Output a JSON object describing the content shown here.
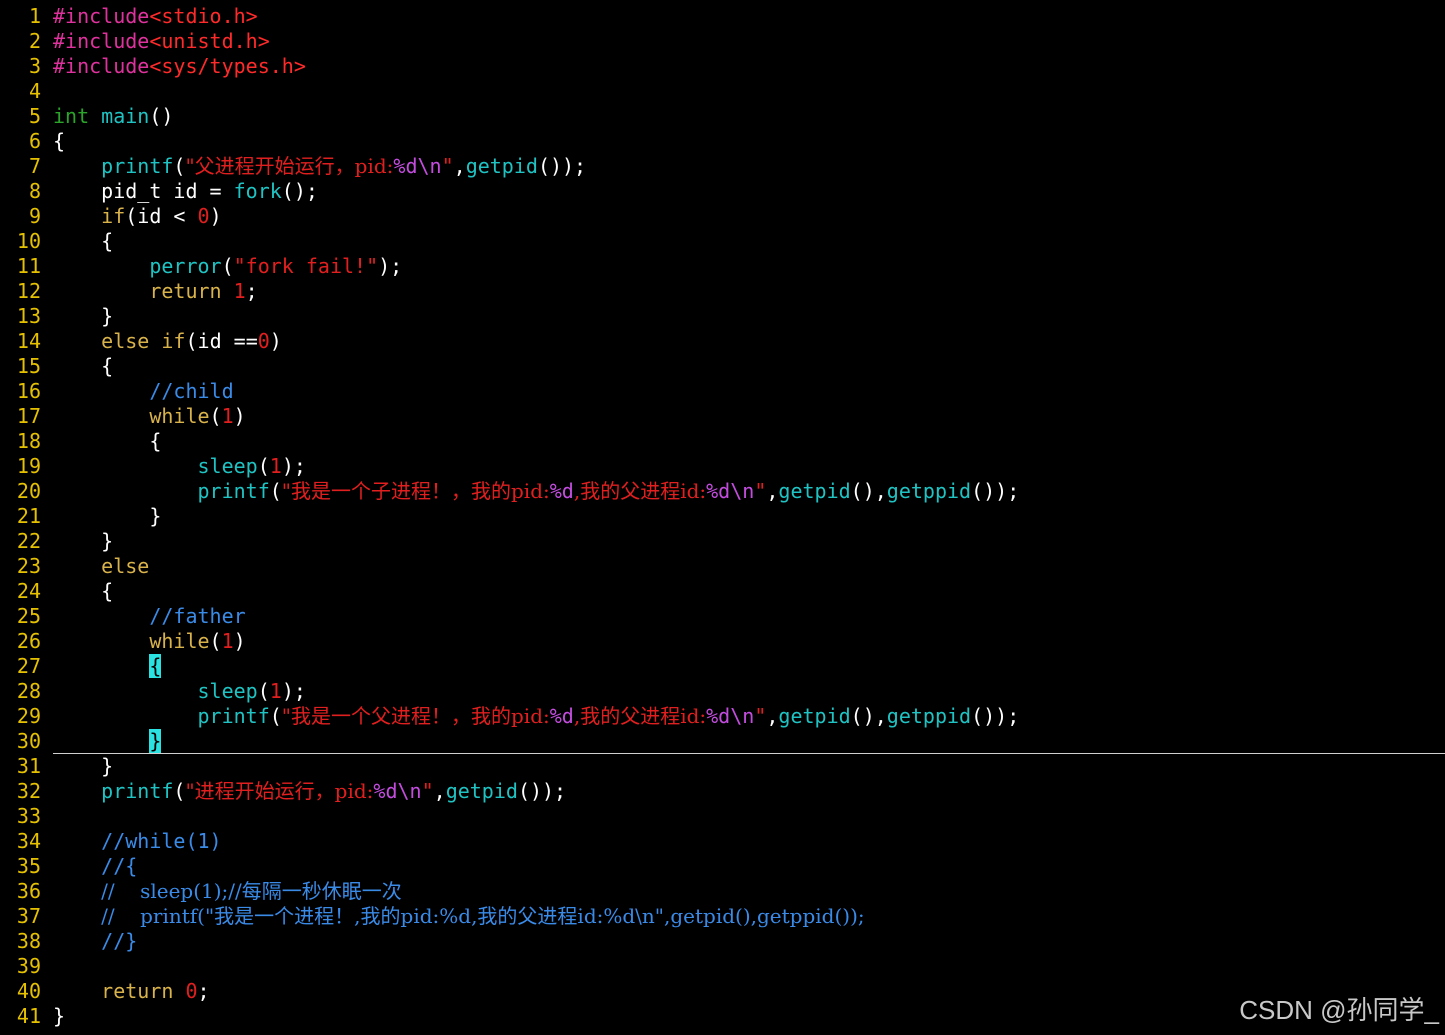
{
  "editor": {
    "lines": [
      {
        "n": "1",
        "tokens": [
          [
            "pre",
            "#include"
          ],
          [
            "inc",
            "<stdio.h>"
          ]
        ]
      },
      {
        "n": "2",
        "tokens": [
          [
            "pre",
            "#include"
          ],
          [
            "inc",
            "<unistd.h>"
          ]
        ]
      },
      {
        "n": "3",
        "tokens": [
          [
            "pre",
            "#include"
          ],
          [
            "inc",
            "<sys/types.h>"
          ]
        ]
      },
      {
        "n": "4",
        "tokens": []
      },
      {
        "n": "5",
        "tokens": [
          [
            "type",
            "int"
          ],
          [
            "plain",
            " "
          ],
          [
            "func",
            "main"
          ],
          [
            "plain",
            "()"
          ]
        ]
      },
      {
        "n": "6",
        "tokens": [
          [
            "plain",
            "{"
          ]
        ]
      },
      {
        "n": "7",
        "tokens": [
          [
            "plain",
            "    "
          ],
          [
            "func",
            "printf"
          ],
          [
            "plain",
            "("
          ],
          [
            "str",
            "\"父进程开始运行，pid:"
          ],
          [
            "esc",
            "%d\\n"
          ],
          [
            "str",
            "\""
          ],
          [
            "plain",
            ","
          ],
          [
            "func",
            "getpid"
          ],
          [
            "plain",
            "());"
          ]
        ]
      },
      {
        "n": "8",
        "tokens": [
          [
            "plain",
            "    pid_t id = "
          ],
          [
            "func",
            "fork"
          ],
          [
            "plain",
            "();"
          ]
        ]
      },
      {
        "n": "9",
        "tokens": [
          [
            "plain",
            "    "
          ],
          [
            "kw",
            "if"
          ],
          [
            "plain",
            "(id < "
          ],
          [
            "num",
            "0"
          ],
          [
            "plain",
            ")"
          ]
        ]
      },
      {
        "n": "10",
        "tokens": [
          [
            "plain",
            "    {"
          ]
        ]
      },
      {
        "n": "11",
        "tokens": [
          [
            "plain",
            "        "
          ],
          [
            "func",
            "perror"
          ],
          [
            "plain",
            "("
          ],
          [
            "str",
            "\"fork fail!\""
          ],
          [
            "plain",
            ");"
          ]
        ]
      },
      {
        "n": "12",
        "tokens": [
          [
            "plain",
            "        "
          ],
          [
            "kw",
            "return"
          ],
          [
            "plain",
            " "
          ],
          [
            "num",
            "1"
          ],
          [
            "plain",
            ";"
          ]
        ]
      },
      {
        "n": "13",
        "tokens": [
          [
            "plain",
            "    }"
          ]
        ]
      },
      {
        "n": "14",
        "tokens": [
          [
            "plain",
            "    "
          ],
          [
            "kw",
            "else"
          ],
          [
            "plain",
            " "
          ],
          [
            "kw",
            "if"
          ],
          [
            "plain",
            "(id =="
          ],
          [
            "num",
            "0"
          ],
          [
            "plain",
            ")"
          ]
        ]
      },
      {
        "n": "15",
        "tokens": [
          [
            "plain",
            "    {"
          ]
        ]
      },
      {
        "n": "16",
        "tokens": [
          [
            "plain",
            "        "
          ],
          [
            "cmt",
            "//child"
          ]
        ]
      },
      {
        "n": "17",
        "tokens": [
          [
            "plain",
            "        "
          ],
          [
            "kw",
            "while"
          ],
          [
            "plain",
            "("
          ],
          [
            "num",
            "1"
          ],
          [
            "plain",
            ")"
          ]
        ]
      },
      {
        "n": "18",
        "tokens": [
          [
            "plain",
            "        {"
          ]
        ]
      },
      {
        "n": "19",
        "tokens": [
          [
            "plain",
            "            "
          ],
          [
            "func",
            "sleep"
          ],
          [
            "plain",
            "("
          ],
          [
            "num",
            "1"
          ],
          [
            "plain",
            ");"
          ]
        ]
      },
      {
        "n": "20",
        "tokens": [
          [
            "plain",
            "            "
          ],
          [
            "func",
            "printf"
          ],
          [
            "plain",
            "("
          ],
          [
            "str",
            "\"我是一个子进程！，我的pid:"
          ],
          [
            "esc",
            "%d"
          ],
          [
            "str",
            ",我的父进程id:"
          ],
          [
            "esc",
            "%d\\n"
          ],
          [
            "str",
            "\""
          ],
          [
            "plain",
            ","
          ],
          [
            "func",
            "getpid"
          ],
          [
            "plain",
            "(),"
          ],
          [
            "func",
            "getppid"
          ],
          [
            "plain",
            "());"
          ]
        ]
      },
      {
        "n": "21",
        "tokens": [
          [
            "plain",
            "        }"
          ]
        ]
      },
      {
        "n": "22",
        "tokens": [
          [
            "plain",
            "    }"
          ]
        ]
      },
      {
        "n": "23",
        "tokens": [
          [
            "plain",
            "    "
          ],
          [
            "kw",
            "else"
          ]
        ]
      },
      {
        "n": "24",
        "tokens": [
          [
            "plain",
            "    {"
          ]
        ]
      },
      {
        "n": "25",
        "tokens": [
          [
            "plain",
            "        "
          ],
          [
            "cmt",
            "//father"
          ]
        ]
      },
      {
        "n": "26",
        "tokens": [
          [
            "plain",
            "        "
          ],
          [
            "kw",
            "while"
          ],
          [
            "plain",
            "("
          ],
          [
            "num",
            "1"
          ],
          [
            "plain",
            ")"
          ]
        ]
      },
      {
        "n": "27",
        "tokens": [
          [
            "plain",
            "        "
          ],
          [
            "cur",
            "{"
          ]
        ]
      },
      {
        "n": "28",
        "tokens": [
          [
            "plain",
            "            "
          ],
          [
            "func",
            "sleep"
          ],
          [
            "plain",
            "("
          ],
          [
            "num",
            "1"
          ],
          [
            "plain",
            ");"
          ]
        ]
      },
      {
        "n": "29",
        "tokens": [
          [
            "plain",
            "            "
          ],
          [
            "func",
            "printf"
          ],
          [
            "plain",
            "("
          ],
          [
            "str",
            "\"我是一个父进程！，我的pid:"
          ],
          [
            "esc",
            "%d"
          ],
          [
            "str",
            ",我的父进程id:"
          ],
          [
            "esc",
            "%d\\n"
          ],
          [
            "str",
            "\""
          ],
          [
            "plain",
            ","
          ],
          [
            "func",
            "getpid"
          ],
          [
            "plain",
            "(),"
          ],
          [
            "func",
            "getppid"
          ],
          [
            "plain",
            "());"
          ]
        ]
      },
      {
        "n": "30",
        "tokens": [
          [
            "plain",
            "        "
          ],
          [
            "cur",
            "}"
          ]
        ],
        "cursorline": true
      },
      {
        "n": "31",
        "tokens": [
          [
            "plain",
            "    }"
          ]
        ]
      },
      {
        "n": "32",
        "tokens": [
          [
            "plain",
            "    "
          ],
          [
            "func",
            "printf"
          ],
          [
            "plain",
            "("
          ],
          [
            "str",
            "\"进程开始运行，pid:"
          ],
          [
            "esc",
            "%d\\n"
          ],
          [
            "str",
            "\""
          ],
          [
            "plain",
            ","
          ],
          [
            "func",
            "getpid"
          ],
          [
            "plain",
            "());"
          ]
        ]
      },
      {
        "n": "33",
        "tokens": []
      },
      {
        "n": "34",
        "tokens": [
          [
            "plain",
            "    "
          ],
          [
            "cmt",
            "//while(1)"
          ]
        ]
      },
      {
        "n": "35",
        "tokens": [
          [
            "plain",
            "    "
          ],
          [
            "cmt",
            "//{"
          ]
        ]
      },
      {
        "n": "36",
        "tokens": [
          [
            "plain",
            "    "
          ],
          [
            "cmt",
            "//    sleep(1);//每隔一秒休眠一次"
          ]
        ]
      },
      {
        "n": "37",
        "tokens": [
          [
            "plain",
            "    "
          ],
          [
            "cmt",
            "//    printf(\"我是一个进程！,我的pid:%d,我的父进程id:%d\\n\",getpid(),getppid());"
          ]
        ]
      },
      {
        "n": "38",
        "tokens": [
          [
            "plain",
            "    "
          ],
          [
            "cmt",
            "//}"
          ]
        ]
      },
      {
        "n": "39",
        "tokens": []
      },
      {
        "n": "40",
        "tokens": [
          [
            "plain",
            "    "
          ],
          [
            "kw",
            "return"
          ],
          [
            "plain",
            " "
          ],
          [
            "num",
            "0"
          ],
          [
            "plain",
            ";"
          ]
        ]
      },
      {
        "n": "41",
        "tokens": [
          [
            "plain",
            "}"
          ]
        ]
      }
    ]
  },
  "watermark": "CSDN @孙同学_"
}
